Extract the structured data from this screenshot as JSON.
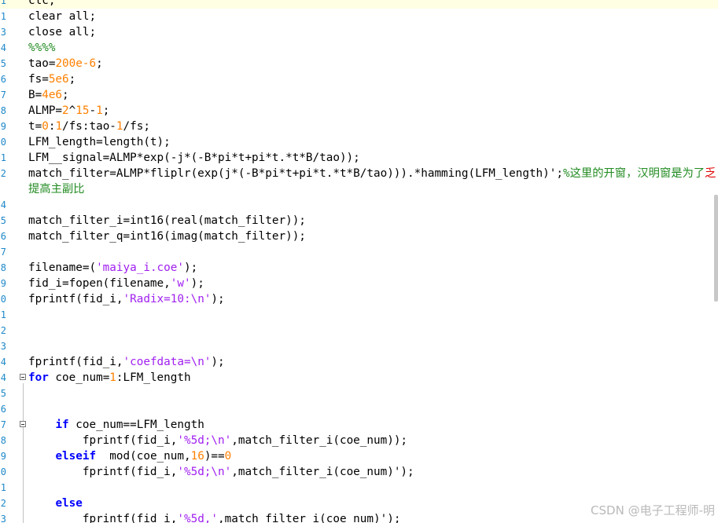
{
  "editor": {
    "lines": [
      {
        "num": "1",
        "tokens": [
          {
            "t": "clc;"
          }
        ]
      },
      {
        "num": "1",
        "tokens": [
          {
            "t": "clear all;"
          }
        ]
      },
      {
        "num": "3",
        "tokens": [
          {
            "t": "close all;"
          }
        ]
      },
      {
        "num": "4",
        "tokens": [
          {
            "t": "%%%%",
            "c": "cm"
          }
        ]
      },
      {
        "num": "5",
        "tokens": [
          {
            "t": "tao="
          },
          {
            "t": "200e-6",
            "c": "num"
          },
          {
            "t": ";"
          }
        ]
      },
      {
        "num": "6",
        "tokens": [
          {
            "t": "fs="
          },
          {
            "t": "5e6",
            "c": "num"
          },
          {
            "t": ";"
          }
        ]
      },
      {
        "num": "7",
        "tokens": [
          {
            "t": "B="
          },
          {
            "t": "4e6",
            "c": "num"
          },
          {
            "t": ";"
          }
        ]
      },
      {
        "num": "8",
        "tokens": [
          {
            "t": "ALMP="
          },
          {
            "t": "2",
            "c": "num"
          },
          {
            "t": "^"
          },
          {
            "t": "15",
            "c": "num"
          },
          {
            "t": "-"
          },
          {
            "t": "1",
            "c": "num"
          },
          {
            "t": ";"
          }
        ]
      },
      {
        "num": "9",
        "tokens": [
          {
            "t": "t="
          },
          {
            "t": "0",
            "c": "num"
          },
          {
            "t": ":"
          },
          {
            "t": "1",
            "c": "num"
          },
          {
            "t": "/fs:tao-"
          },
          {
            "t": "1",
            "c": "num"
          },
          {
            "t": "/fs;"
          }
        ]
      },
      {
        "num": "0",
        "tokens": [
          {
            "t": "LFM_length=length(t);"
          }
        ]
      },
      {
        "num": "1",
        "tokens": [
          {
            "t": "LFM__signal=ALMP*exp(-j*(-B*pi*t+pi*t.*t*B/tao));"
          }
        ]
      },
      {
        "num": "2",
        "tokens": [
          {
            "t": "match_filter=ALMP*fliplr(exp(j*(-B*pi*t+pi*t.*t*B/tao))).*hamming(LFM_length)';"
          },
          {
            "t": "%这里的开窗，汉明窗是为了",
            "c": "cm"
          },
          {
            "t": "乏",
            "c": "red"
          }
        ]
      },
      {
        "num": "",
        "tokens": [
          {
            "t": "提高主副比",
            "c": "cm"
          }
        ]
      },
      {
        "num": "4",
        "tokens": []
      },
      {
        "num": "5",
        "tokens": [
          {
            "t": "match_filter_i=int16(real(match_filter));"
          }
        ]
      },
      {
        "num": "6",
        "tokens": [
          {
            "t": "match_filter_q=int16(imag(match_filter));"
          }
        ]
      },
      {
        "num": "7",
        "tokens": []
      },
      {
        "num": "8",
        "tokens": [
          {
            "t": "filename=("
          },
          {
            "t": "'maiya_i.coe'",
            "c": "str"
          },
          {
            "t": ");"
          }
        ]
      },
      {
        "num": "9",
        "tokens": [
          {
            "t": "fid_i=fopen(filename,"
          },
          {
            "t": "'w'",
            "c": "str"
          },
          {
            "t": ");"
          }
        ]
      },
      {
        "num": "0",
        "tokens": [
          {
            "t": "fprintf(fid_i,"
          },
          {
            "t": "'Radix=10:\\n'",
            "c": "str"
          },
          {
            "t": ");"
          }
        ]
      },
      {
        "num": "1",
        "tokens": []
      },
      {
        "num": "2",
        "tokens": []
      },
      {
        "num": "3",
        "tokens": []
      },
      {
        "num": "4",
        "tokens": [
          {
            "t": "fprintf(fid_i,"
          },
          {
            "t": "'coefdata=\\n'",
            "c": "str"
          },
          {
            "t": ");"
          }
        ]
      },
      {
        "num": "4",
        "fold": true,
        "tokens": [
          {
            "t": "for",
            "c": "kw"
          },
          {
            "t": " coe_num="
          },
          {
            "t": "1",
            "c": "num"
          },
          {
            "t": ":LFM_length"
          }
        ]
      },
      {
        "num": "5",
        "tokens": []
      },
      {
        "num": "6",
        "tokens": []
      },
      {
        "num": "7",
        "fold": true,
        "tokens": [
          {
            "t": "    "
          },
          {
            "t": "if",
            "c": "kw"
          },
          {
            "t": " coe_num==LFM_length"
          }
        ]
      },
      {
        "num": "8",
        "tokens": [
          {
            "t": "        fprintf(fid_i,"
          },
          {
            "t": "'%5d;\\n'",
            "c": "str"
          },
          {
            "t": ",match_filter_i(coe_num));"
          }
        ]
      },
      {
        "num": "9",
        "tokens": [
          {
            "t": "    "
          },
          {
            "t": "elseif",
            "c": "kw"
          },
          {
            "t": "  mod(coe_num,"
          },
          {
            "t": "16",
            "c": "num"
          },
          {
            "t": ")=="
          },
          {
            "t": "0",
            "c": "num"
          }
        ]
      },
      {
        "num": "0",
        "tokens": [
          {
            "t": "        fprintf(fid_i,"
          },
          {
            "t": "'%5d;\\n'",
            "c": "str"
          },
          {
            "t": ",match_filter_i(coe_num)');"
          }
        ]
      },
      {
        "num": "1",
        "tokens": []
      },
      {
        "num": "2",
        "tokens": [
          {
            "t": "    "
          },
          {
            "t": "else",
            "c": "kw"
          }
        ]
      },
      {
        "num": "3",
        "tokens": [
          {
            "t": "        fprintf(fid_i,"
          },
          {
            "t": "'%5d,'",
            "c": "str"
          },
          {
            "t": ",match_filter_i(coe_num)');"
          }
        ]
      }
    ]
  },
  "colors": {
    "keyword": "#0000ff",
    "number": "#ff8000",
    "string": "#a020f0",
    "comment": "#228b22",
    "line_number": "#1e88c8",
    "current_line": "#ffffe4"
  },
  "watermark": "CSDN @电子工程师-明"
}
